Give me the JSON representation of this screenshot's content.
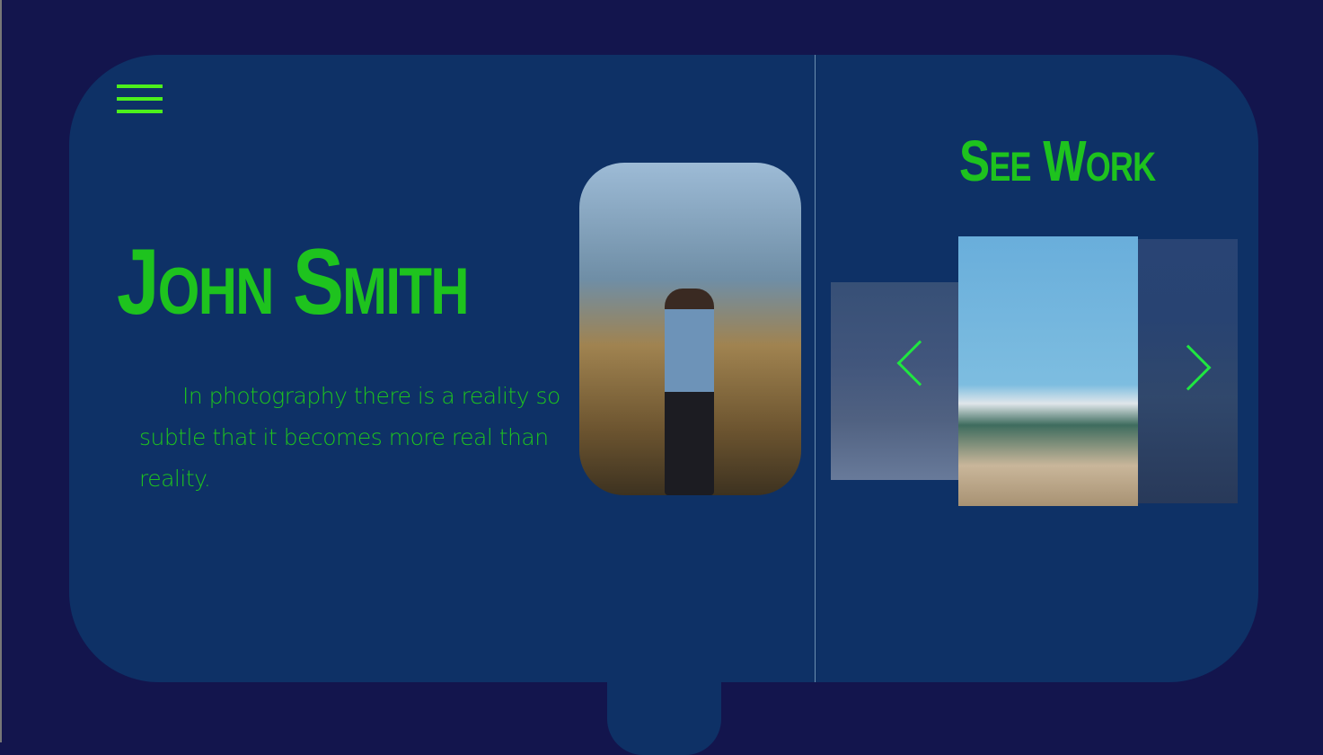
{
  "hero": {
    "name": "John Smith",
    "quote": "In photography there is a reality so subtle that it becomes more real than reality."
  },
  "gallery": {
    "title": "See Work",
    "prev_icon": "chevron-left-icon",
    "next_icon": "chevron-right-icon"
  },
  "menu_icon": "hamburger-menu-icon",
  "colors": {
    "background": "#13154d",
    "card": "#0e3166",
    "accent": "#1ec31e",
    "arrow": "#1fe640"
  }
}
